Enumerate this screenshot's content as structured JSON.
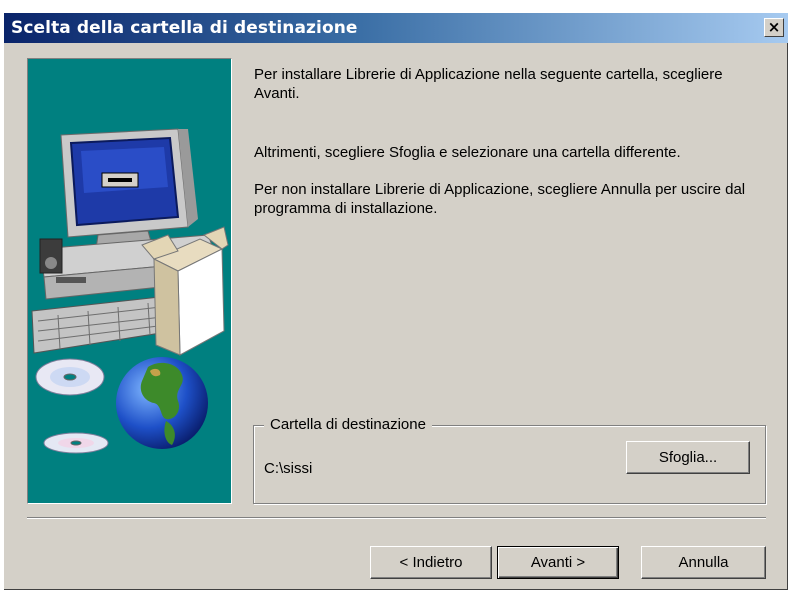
{
  "window": {
    "title": "Scelta della cartella di destinazione",
    "close_label": "×"
  },
  "message": {
    "line1": "Per installare Librerie di Applicazione nella seguente cartella, scegliere Avanti.",
    "line2": "Altrimenti, scegliere Sfoglia e selezionare una cartella differente.",
    "line3": "Per non installare Librerie di Applicazione, scegliere Annulla per uscire dal programma di installazione."
  },
  "destination": {
    "group_label": "Cartella di destinazione",
    "path": "C:\\sissi",
    "browse_label": "Sfoglia..."
  },
  "buttons": {
    "back": "< Indietro",
    "next": "Avanti >",
    "cancel": "Annulla"
  },
  "colors": {
    "titlebar_start": "#0a246a",
    "titlebar_end": "#a6caf0",
    "dialog_bg": "#d4d0c8",
    "picture_bg": "#008080"
  },
  "icons": [
    "computer-illustration",
    "cd-discs-icon",
    "globe-icon"
  ]
}
